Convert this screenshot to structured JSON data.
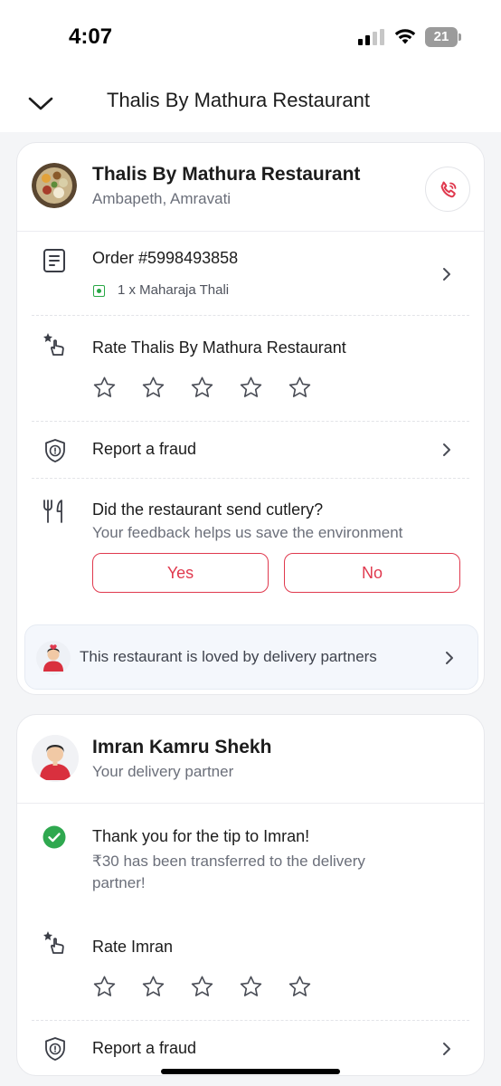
{
  "status_bar": {
    "time": "4:07",
    "battery": "21"
  },
  "header": {
    "title": "Thalis By Mathura Restaurant"
  },
  "restaurant": {
    "name": "Thalis By Mathura Restaurant",
    "location": "Ambapeth, Amravati"
  },
  "order": {
    "label": "Order #5998493858",
    "item": "1 x Maharaja Thali"
  },
  "rate_restaurant": {
    "label": "Rate Thalis By Mathura Restaurant",
    "stars": 0,
    "max_stars": 5
  },
  "fraud_1": {
    "label": "Report a fraud"
  },
  "cutlery": {
    "question": "Did the restaurant send cutlery?",
    "subtext": "Your feedback helps us save the environment",
    "yes": "Yes",
    "no": "No"
  },
  "loved_banner": {
    "text": "This restaurant is loved by delivery partners"
  },
  "partner": {
    "name": "Imran Kamru Shekh",
    "role": "Your delivery partner"
  },
  "tip": {
    "title": "Thank you for the tip to Imran!",
    "subtext": "₹30 has been transferred to the delivery partner!"
  },
  "rate_partner": {
    "label": "Rate Imran",
    "stars": 0,
    "max_stars": 5
  },
  "fraud_2": {
    "label": "Report a fraud"
  },
  "colors": {
    "accent": "#e0394e",
    "success": "#28a745",
    "text_muted": "#6b6f7a"
  }
}
